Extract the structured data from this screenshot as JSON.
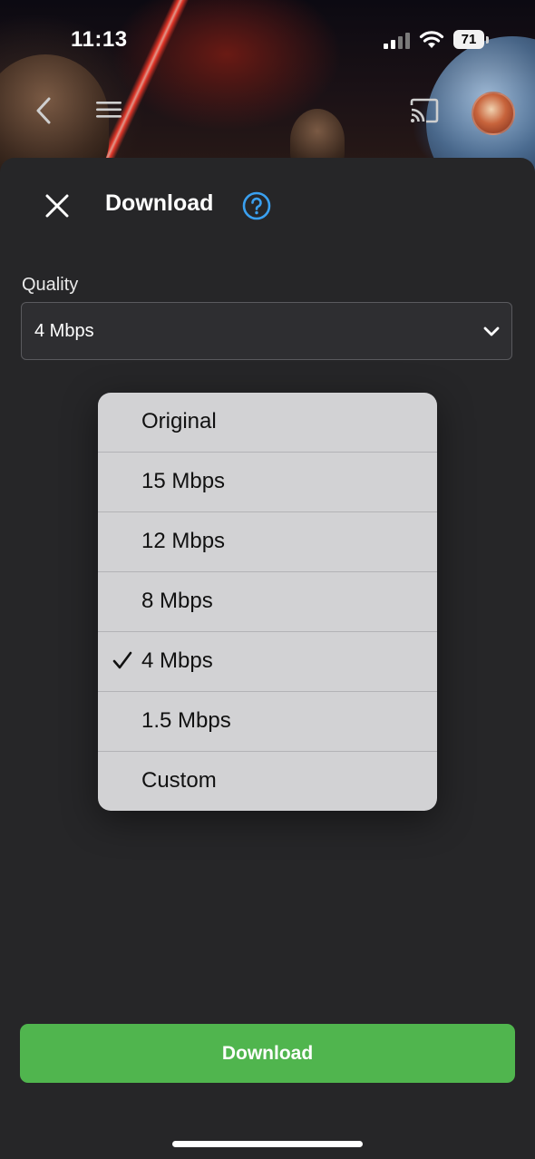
{
  "status_bar": {
    "time": "11:13",
    "battery": "71"
  },
  "top_nav": {
    "back_icon": "chevron-left-icon",
    "menu_icon": "hamburger-icon",
    "cast_icon": "cast-icon"
  },
  "sheet": {
    "title": "Download",
    "close_icon": "close-icon",
    "help_icon": "help-icon"
  },
  "quality": {
    "label": "Quality",
    "selected": "4 Mbps"
  },
  "menu": {
    "items": [
      {
        "label": "Original",
        "checked": false
      },
      {
        "label": "15 Mbps",
        "checked": false
      },
      {
        "label": "12 Mbps",
        "checked": false
      },
      {
        "label": "8 Mbps",
        "checked": false
      },
      {
        "label": "4 Mbps",
        "checked": true
      },
      {
        "label": "1.5 Mbps",
        "checked": false
      },
      {
        "label": "Custom",
        "checked": false
      }
    ]
  },
  "download_button": {
    "label": "Download"
  },
  "colors": {
    "accent_green": "#50b54e",
    "help_blue": "#3aa0f0",
    "sheet_bg": "#262628"
  }
}
